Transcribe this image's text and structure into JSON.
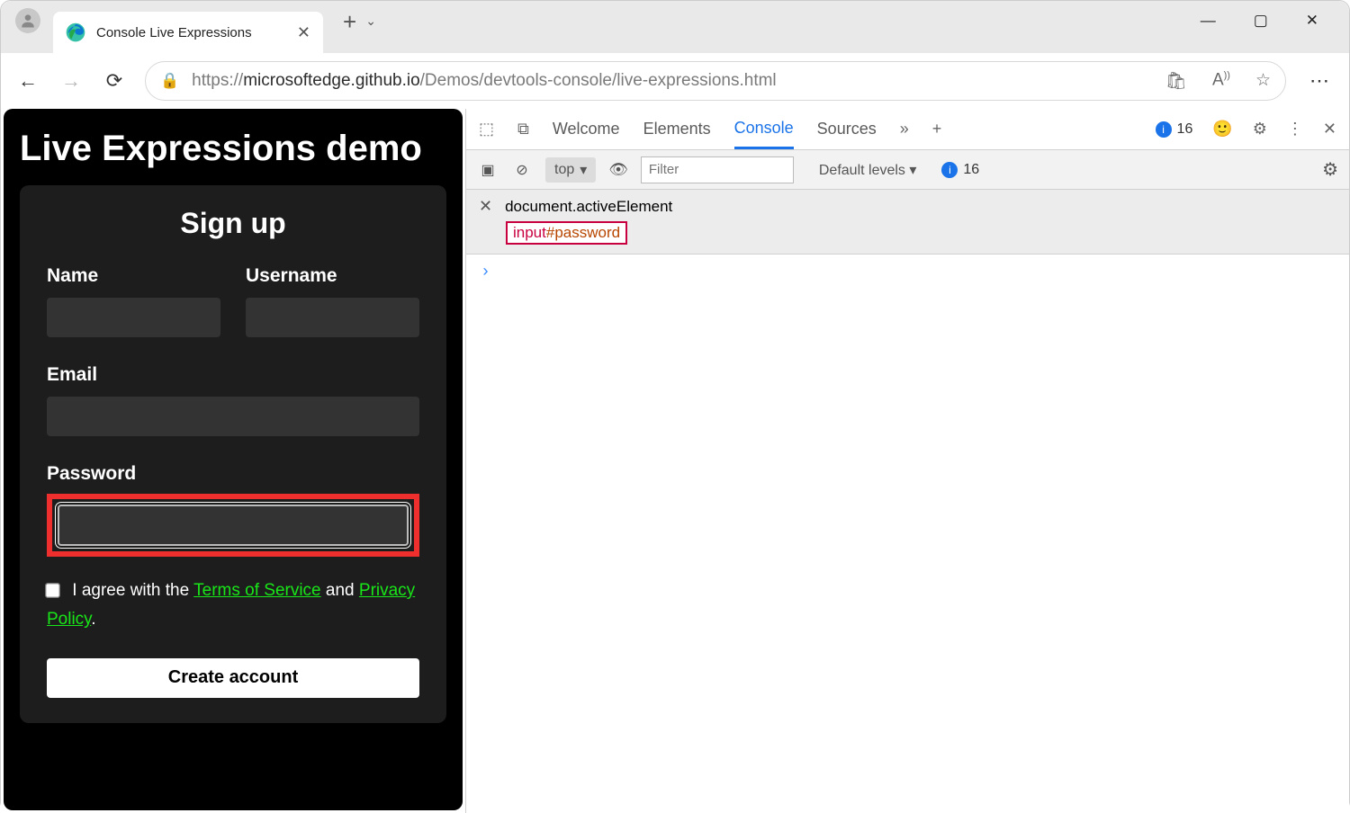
{
  "browser": {
    "tab_title": "Console Live Expressions",
    "url_grey_pre": "https://",
    "url_host": "microsoftedge.github.io",
    "url_path": "/Demos/devtools-console/live-expressions.html"
  },
  "page": {
    "title": "Live Expressions demo",
    "heading": "Sign up",
    "labels": {
      "name": "Name",
      "username": "Username",
      "email": "Email",
      "password": "Password"
    },
    "agree_pre": "I agree with the ",
    "tos": "Terms of Service",
    "agree_mid": " and ",
    "pp": "Privacy Policy",
    "agree_post": ".",
    "button": "Create account"
  },
  "devtools": {
    "tabs": {
      "welcome": "Welcome",
      "elements": "Elements",
      "console": "Console",
      "sources": "Sources"
    },
    "issues": "16",
    "toolbar": {
      "context": "top",
      "filter_ph": "Filter",
      "levels": "Default levels",
      "issues2": "16"
    },
    "live_expression": {
      "code": "document.activeElement",
      "result_tag": "input",
      "result_sel": "#password"
    },
    "prompt": "›"
  }
}
